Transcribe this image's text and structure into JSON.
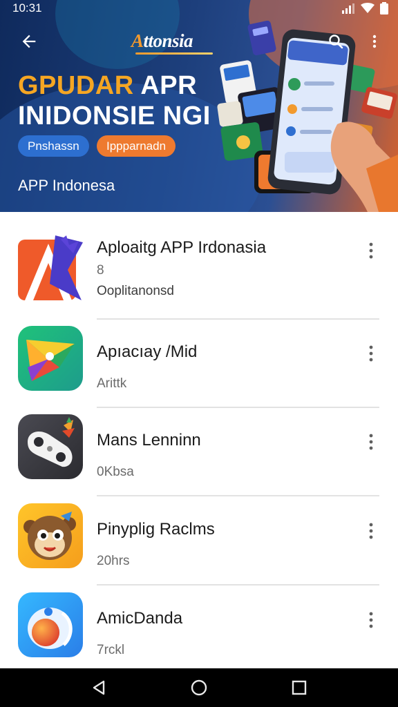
{
  "status_bar": {
    "time": "10:31"
  },
  "header": {
    "brand_prefix": "A",
    "brand_rest": "ttonsia",
    "hero_title_orange": "GPUDAR",
    "hero_title_white": " APR",
    "hero_title_line2": "INIDONSIE NGI",
    "chip_blue": "Pnshassn",
    "chip_orange": "Ippparnadn",
    "subtitle": "APP Indonesa"
  },
  "apps": [
    {
      "name": "Aploaitg  APP Irdonasia",
      "meta1": "8",
      "meta2": "Ooplitanonsd"
    },
    {
      "name": "Apıacıay /Mid",
      "meta1": "Arittk"
    },
    {
      "name": "Mans Lenninn",
      "meta1": "0Kbsa"
    },
    {
      "name": "Pinyplig Raclms",
      "meta1": "20hrs"
    },
    {
      "name": "AmicDanda",
      "meta1": "7rckl"
    }
  ],
  "colors": {
    "accent_orange": "#f5a623",
    "chip_blue": "#2d6fd0",
    "chip_orange": "#ee7a2f",
    "hero_bg": "#1d3f7c"
  },
  "icons": [
    "back-arrow-icon",
    "search-icon",
    "more-vert-icon",
    "wifi-icon",
    "signal-icon",
    "battery-icon",
    "nav-back-icon",
    "nav-home-icon",
    "nav-recents-icon"
  ]
}
